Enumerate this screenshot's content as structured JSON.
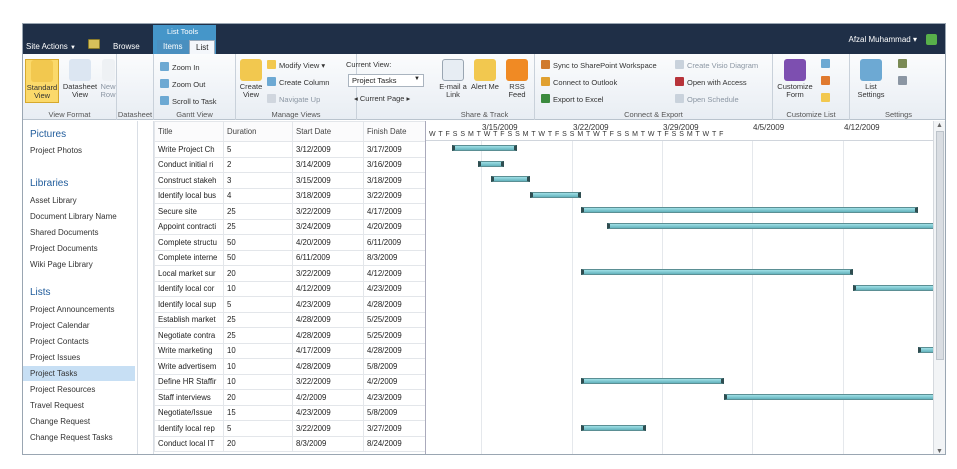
{
  "topbar": {
    "site_actions": "Site Actions",
    "browse": "Browse",
    "list_tools": "List Tools",
    "tab_items": "Items",
    "tab_list": "List",
    "user": "Afzal Muhammad"
  },
  "ribbon": {
    "groups": [
      "View Format",
      "Datasheet",
      "Gantt View",
      "Manage Views",
      "Share & Track",
      "Connect & Export",
      "Customize List",
      "Settings"
    ],
    "standard_view": "Standard View",
    "datasheet_view": "Datasheet View",
    "new_row": "New Row",
    "zoom_in": "Zoom In",
    "zoom_out": "Zoom Out",
    "scroll_to_task": "Scroll to Task",
    "create_view": "Create View",
    "modify_view": "Modify View",
    "create_column": "Create Column",
    "navigate_up": "Navigate Up",
    "current_view_label": "Current View:",
    "current_view_value": "Project Tasks",
    "current_page": "Current Page",
    "email_link": "E-mail a Link",
    "alert_me": "Alert Me",
    "rss_feed": "RSS Feed",
    "sync_sharepoint": "Sync to SharePoint Workspace",
    "connect_outlook": "Connect to Outlook",
    "export_excel": "Export to Excel",
    "create_visio": "Create Visio Diagram",
    "open_access": "Open with Access",
    "open_schedule": "Open Schedule",
    "customize_form": "Customize Form",
    "list_settings": "List Settings"
  },
  "nav": {
    "pictures": "Pictures",
    "project_photos": "Project Photos",
    "libraries": "Libraries",
    "library_items": [
      "Asset Library",
      "Document Library Name",
      "Shared Documents",
      "Project Documents",
      "Wiki Page Library"
    ],
    "lists": "Lists",
    "list_items": [
      "Project Announcements",
      "Project Calendar",
      "Project Contacts",
      "Project Issues",
      "Project Tasks",
      "Project Resources",
      "Travel Request",
      "Change Request",
      "Change Request Tasks"
    ]
  },
  "sheet": {
    "headers": [
      "Title",
      "Duration",
      "Start Date",
      "Finish Date"
    ],
    "rows": [
      [
        "Write Project Ch",
        "5",
        "3/12/2009",
        "3/17/2009"
      ],
      [
        "Conduct initial ri",
        "2",
        "3/14/2009",
        "3/16/2009"
      ],
      [
        "Construct stakeh",
        "3",
        "3/15/2009",
        "3/18/2009"
      ],
      [
        "Identify local bus",
        "4",
        "3/18/2009",
        "3/22/2009"
      ],
      [
        "Secure site",
        "25",
        "3/22/2009",
        "4/17/2009"
      ],
      [
        "Appoint contracti",
        "25",
        "3/24/2009",
        "4/20/2009"
      ],
      [
        "Complete structu",
        "50",
        "4/20/2009",
        "6/11/2009"
      ],
      [
        "Complete interne",
        "50",
        "6/11/2009",
        "8/3/2009"
      ],
      [
        "Local market sur",
        "20",
        "3/22/2009",
        "4/12/2009"
      ],
      [
        "Identify local cor",
        "10",
        "4/12/2009",
        "4/23/2009"
      ],
      [
        "Identify local sup",
        "5",
        "4/23/2009",
        "4/28/2009"
      ],
      [
        "Establish market",
        "25",
        "4/28/2009",
        "5/25/2009"
      ],
      [
        "Negotiate contra",
        "25",
        "4/28/2009",
        "5/25/2009"
      ],
      [
        "Write marketing",
        "10",
        "4/17/2009",
        "4/28/2009"
      ],
      [
        "Write advertisem",
        "10",
        "4/28/2009",
        "5/8/2009"
      ],
      [
        "Define HR Staffir",
        "10",
        "3/22/2009",
        "4/2/2009"
      ],
      [
        "Staff interviews",
        "20",
        "4/2/2009",
        "4/23/2009"
      ],
      [
        "Negotiate/Issue",
        "15",
        "4/23/2009",
        "5/8/2009"
      ],
      [
        "Identify local rep",
        "5",
        "3/22/2009",
        "3/27/2009"
      ],
      [
        "Conduct local IT",
        "20",
        "8/3/2009",
        "8/24/2009"
      ]
    ]
  },
  "gantt": {
    "weeks": [
      "3/15/2009",
      "3/22/2009",
      "3/29/2009",
      "4/5/2009",
      "4/12/2009"
    ],
    "days": "W T F S S M T W T F S S M T W T F S S M T W T F S S M T W T F S S M T W T F"
  }
}
